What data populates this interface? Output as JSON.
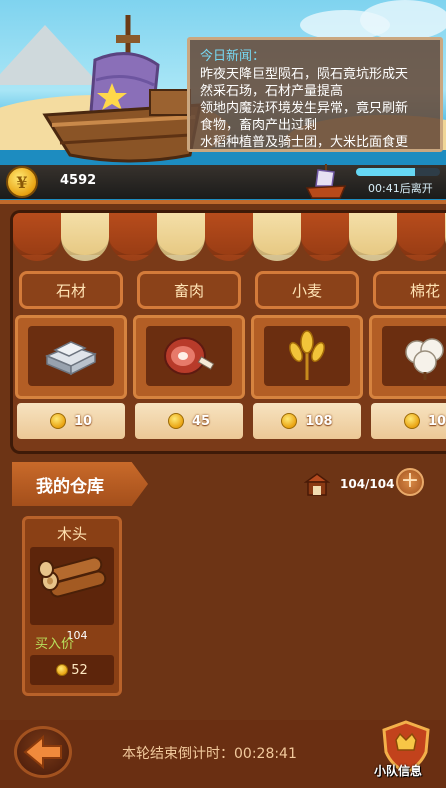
{
  "news": {
    "title": "今日新闻：",
    "lines": [
      "昨夜天降巨型陨石，陨石竟坑形成天",
      "然采石场，石材产量提高",
      "领地内魔法环境发生异常，竟只刷新",
      "食物，畜肉产出过剩",
      "水稻种植普及骑士团，大米比面食更"
    ]
  },
  "status": {
    "coins": "4592",
    "depart_text": "00:41后离开",
    "depart_progress": 0.7
  },
  "market": {
    "stalls": [
      {
        "label": "石材",
        "price": "10",
        "icon": "stone-icon"
      },
      {
        "label": "畜肉",
        "price": "45",
        "icon": "meat-icon"
      },
      {
        "label": "小麦",
        "price": "108",
        "icon": "wheat-icon"
      },
      {
        "label": "棉花",
        "price": "10",
        "icon": "cotton-icon"
      }
    ]
  },
  "warehouse": {
    "title": "我的仓库",
    "capacity": "104/104",
    "items": [
      {
        "name": "木头",
        "count": "104",
        "buy_label": "买入价",
        "buy_price": "52",
        "icon": "wood-icon"
      }
    ]
  },
  "footer": {
    "countdown": "本轮结束倒计时：00:28:41",
    "team_label": "小队信息"
  }
}
